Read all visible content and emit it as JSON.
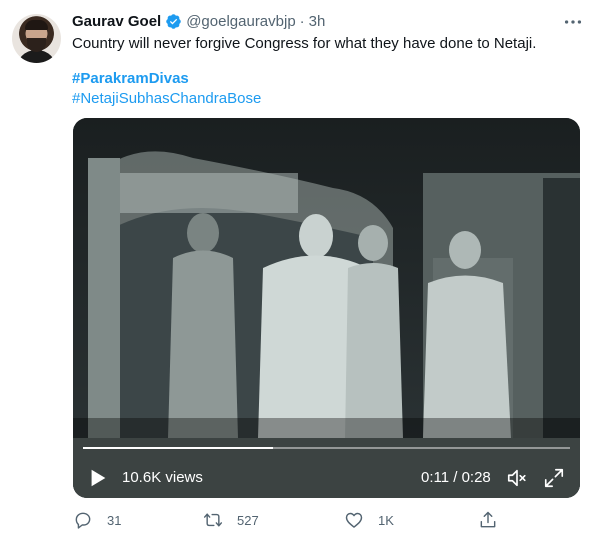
{
  "tweet": {
    "author_name": "Gaurav Goel",
    "handle": "@goelgauravbjp",
    "separator": "·",
    "time": "3h",
    "text": "Country will never forgive Congress for what they have done to Netaji.",
    "hashtags": [
      "#ParakramDivas",
      "#NetajiSubhasChandraBose"
    ]
  },
  "video": {
    "views": "10.6K views",
    "time_display": "0:11 / 0:28",
    "progress": 0.39
  },
  "actions": {
    "replies": "31",
    "retweets": "527",
    "likes": "1K"
  },
  "icons": {
    "verified": "verified-badge-icon",
    "more": "more-icon",
    "play": "play-icon",
    "volume": "volume-icon",
    "fullscreen": "fullscreen-icon",
    "reply": "reply-icon",
    "retweet": "retweet-icon",
    "like": "like-icon",
    "share": "share-icon"
  },
  "colors": {
    "accent": "#1d9bf0",
    "secondary_text": "#536471"
  }
}
